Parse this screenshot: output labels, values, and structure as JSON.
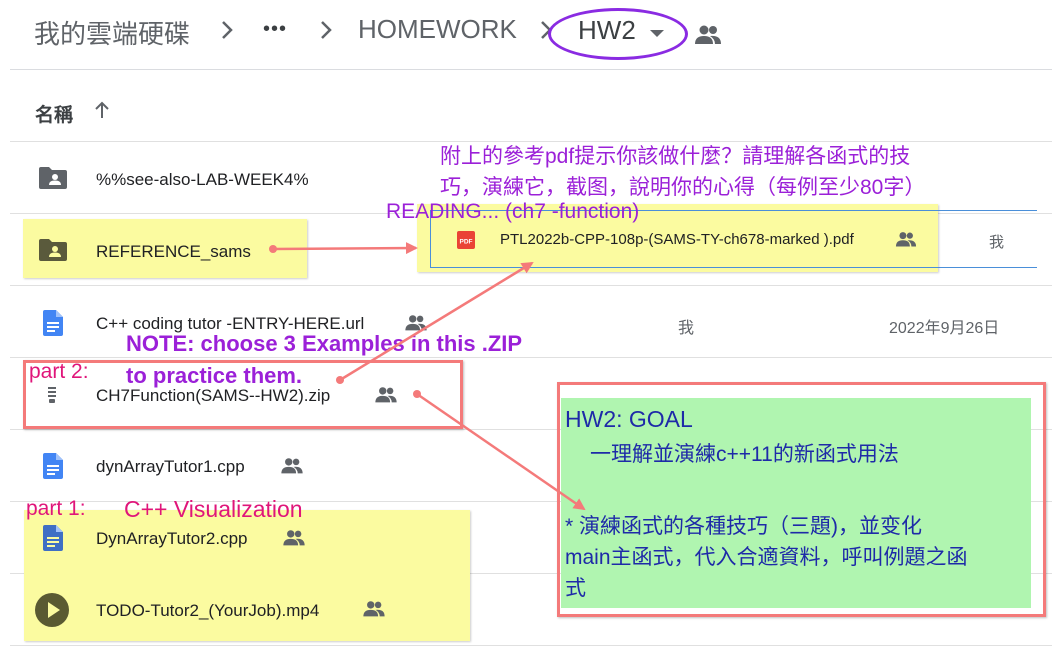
{
  "breadcrumb": {
    "root": "我的雲端硬碟",
    "more": "•••",
    "parent": "HOMEWORK",
    "current": "HW2"
  },
  "header": {
    "name_label": "名稱"
  },
  "files": [
    {
      "name": "%%see-also-LAB-WEEK4%",
      "icon": "shared-folder-icon",
      "owner": "",
      "modified": ""
    },
    {
      "name": "REFERENCE_sams",
      "icon": "shared-folder-icon",
      "owner": "",
      "modified": ""
    },
    {
      "name": "C++ coding tutor -ENTRY-HERE.url",
      "icon": "doc-icon",
      "shared": true,
      "owner": "我",
      "modified": "2022年9月26日"
    },
    {
      "name": "CH7Function(SAMS--HW2).zip",
      "icon": "zip-icon",
      "shared": true,
      "owner": "",
      "modified": ""
    },
    {
      "name": "dynArrayTutor1.cpp",
      "icon": "doc-icon",
      "shared": true,
      "owner": "",
      "modified": ""
    },
    {
      "name": "DynArrayTutor2.cpp",
      "icon": "doc-icon",
      "shared": true,
      "owner": "",
      "modified": ""
    },
    {
      "name": "TODO-Tutor2_(YourJob).mp4",
      "icon": "video-icon",
      "shared": true,
      "owner": "",
      "modified": ""
    }
  ],
  "pdf_file": {
    "name": "PTL2022b-CPP-108p-(SAMS-TY-ch678-marked ).pdf",
    "badge": "PDF",
    "owner": "我"
  },
  "annotations": {
    "pdf_hint_line1": "附上的參考pdf提示你該做什麼？請理解各函式的技",
    "pdf_hint_line2": "巧，演練它，截图，說明你的心得（每例至少80字）",
    "reading": "READING... (ch7 -function)",
    "note_line1": "NOTE:  choose 3 Examples in this .ZIP",
    "note_line2": "to practice them.",
    "part2": "part 2:",
    "part1": "part 1:",
    "part1_title": "C++ Visualization",
    "goal_title": "HW2: GOAL",
    "goal_line1": "一理解並演練c++11的新函式用法",
    "goal_line2": "*  演練函式的各種技巧（三題)，並变化",
    "goal_line3": "main主函式，代入合適資料，呼叫例題之函",
    "goal_line4": "式"
  },
  "colors": {
    "annotation_purple": "#9b20d8",
    "annotation_magenta": "#e0157a",
    "goal_text": "#1e2aa8",
    "goal_bg": "#b0f5b0",
    "highlight_yellow": "#fbfba0",
    "arrow_red": "#f47a7a",
    "doc_blue": "#4285f4",
    "pdf_red": "#ea4335"
  }
}
